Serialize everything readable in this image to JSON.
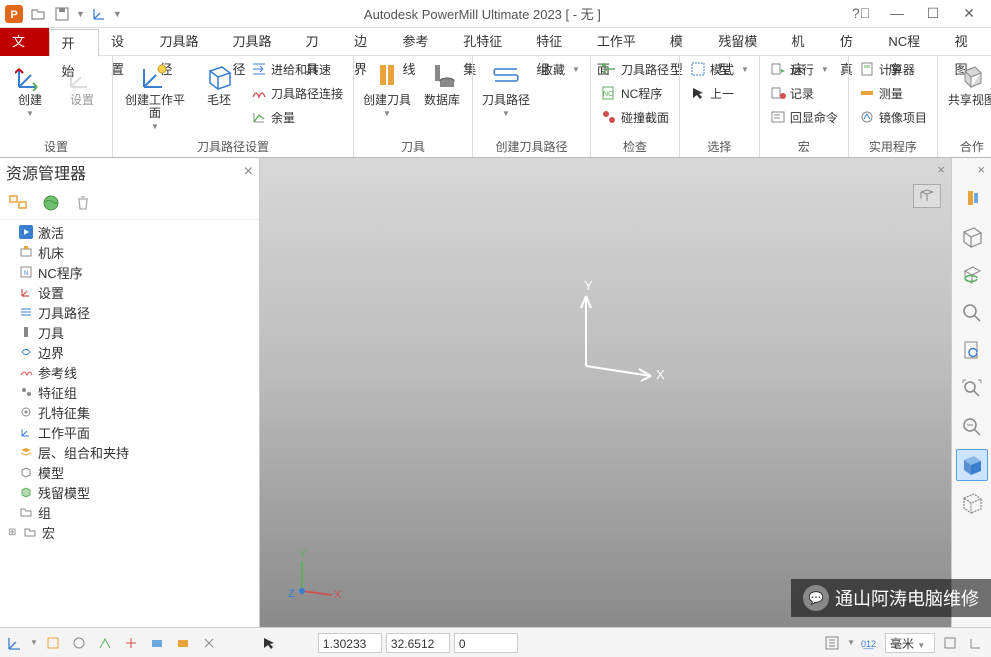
{
  "title": "Autodesk PowerMill Ultimate 2023    [ - 无 ]",
  "tabs": {
    "file": "文件",
    "home": "开始",
    "list": [
      "设置",
      "刀具路径",
      "刀具路径",
      "刀具",
      "边界",
      "参考线",
      "孔特征集",
      "特征组",
      "工作平面",
      "模型",
      "残留模型",
      "机床",
      "仿真",
      "NC程序",
      "视图"
    ]
  },
  "ribbon": {
    "group_setup": "设置",
    "group_toolpath_settings": "刀具路径设置",
    "group_tool": "刀具",
    "group_create_toolpath": "创建刀具路径",
    "group_check": "检查",
    "group_select": "选择",
    "group_macro": "宏",
    "group_utility": "实用程序",
    "group_collab": "合作",
    "btn_create": "创建",
    "btn_settings": "设置",
    "btn_create_wp": "创建工作平面",
    "btn_block": "毛坯",
    "btn_feed_speed": "进给和转速",
    "btn_toolpath_conn": "刀具路径连接",
    "btn_stock": "余量",
    "btn_create_tool": "创建刀具",
    "btn_database": "数据库",
    "btn_toolpath": "刀具路径",
    "btn_favorite": "收藏",
    "btn_tp_check": "刀具路径",
    "btn_nc_check": "NC程序",
    "btn_collision": "碰撞截面",
    "btn_mode": "模式",
    "btn_prev": "上一",
    "btn_run": "运行",
    "btn_record": "记录",
    "btn_echo": "回显命令",
    "btn_calculator": "计算器",
    "btn_measure": "测量",
    "btn_mirror": "镜像项目",
    "btn_share_view": "共享视图"
  },
  "explorer": {
    "title": "资源管理器",
    "items": [
      "激活",
      "机床",
      "NC程序",
      "设置",
      "刀具路径",
      "刀具",
      "边界",
      "参考线",
      "特征组",
      "孔特征集",
      "工作平面",
      "层、组合和夹持",
      "模型",
      "残留模型",
      "组",
      "宏"
    ]
  },
  "axes": {
    "x": "X",
    "y": "Y",
    "z": "Z"
  },
  "status": {
    "coord1": "1.30233",
    "coord2": "32.6512",
    "coord3": "0",
    "unit": "毫米"
  },
  "watermark": "通山阿涛电脑维修"
}
